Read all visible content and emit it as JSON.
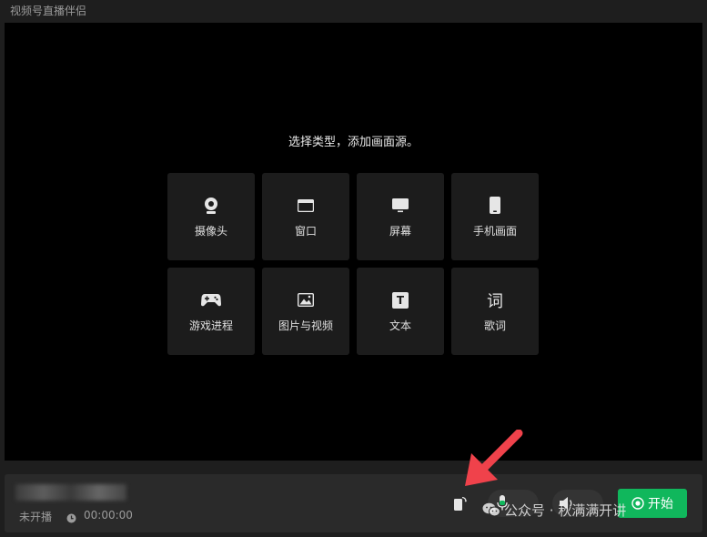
{
  "window": {
    "title": "视频号直播伴侣"
  },
  "stage": {
    "prompt": "选择类型，添加画面源。",
    "sources": [
      {
        "label": "摄像头",
        "icon": "camera-icon"
      },
      {
        "label": "窗口",
        "icon": "window-icon"
      },
      {
        "label": "屏幕",
        "icon": "monitor-icon"
      },
      {
        "label": "手机画面",
        "icon": "phone-icon"
      },
      {
        "label": "游戏进程",
        "icon": "gamepad-icon"
      },
      {
        "label": "图片与视频",
        "icon": "image-icon"
      },
      {
        "label": "文本",
        "icon": "text-icon"
      },
      {
        "label": "歌词",
        "icon": "lyrics-icon"
      }
    ],
    "lyrics_glyph": "词",
    "text_glyph": "T"
  },
  "bottom": {
    "status": "未开播",
    "timer": "00:00:00",
    "start_label": "开始",
    "accent": "#10b75c"
  },
  "watermark": {
    "text": "公众号 · 秋满满开讲"
  }
}
